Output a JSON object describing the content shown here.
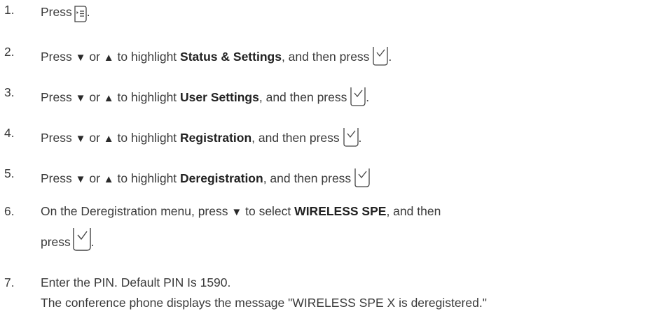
{
  "steps": [
    {
      "number": "1.",
      "before": "Press",
      "icon": "menu-key-icon",
      "after": "."
    },
    {
      "number": "2.",
      "press": "Press",
      "down": "▼",
      "or": "or",
      "up": "▲",
      "mid": "to highlight",
      "item": "Status & Settings",
      "tail": ", and then press",
      "icon": "ok-check-key-icon",
      "end": "."
    },
    {
      "number": "3.",
      "press": "Press",
      "down": "▼",
      "or": "or",
      "up": "▲",
      "mid": "to highlight",
      "item": "User Settings",
      "tail": ", and then press",
      "icon": "ok-check-key-icon",
      "end": "."
    },
    {
      "number": "4.",
      "press": "Press",
      "down": "▼",
      "or": "or",
      "up": "▲",
      "mid": "to highlight",
      "item": "Registration",
      "tail": ", and then press",
      "icon": "ok-check-key-icon",
      "end": "."
    },
    {
      "number": "5.",
      "press": "Press",
      "down": "▼",
      "or": "or",
      "up": "▲",
      "mid": "to highlight",
      "item": "Deregistration",
      "tail": ", and then press",
      "icon": "ok-check-key-icon",
      "end": ""
    },
    {
      "number": "6.",
      "lead": "On the Deregistration menu, press",
      "down": "▼",
      "mid": "to select",
      "item": "WIRELESS SPE",
      "tail": ", and then",
      "line2": "press",
      "icon": "ok-check-key-icon",
      "end": "."
    },
    {
      "number": "7.",
      "text": "Enter the PIN. Default PIN Is 1590.",
      "line2": "The conference phone displays the message \"WIRELESS SPE X is deregistered.\""
    }
  ]
}
